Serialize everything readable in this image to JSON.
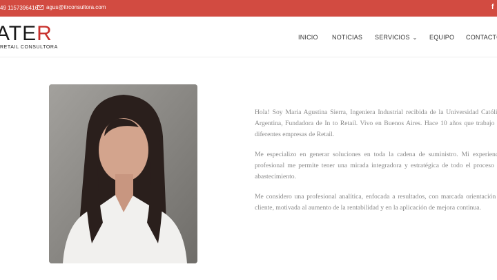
{
  "topbar": {
    "phone": "49 1157396416",
    "email": "agus@itrconsultora.com",
    "social_icon": "f"
  },
  "logo": {
    "mark_left": "ATE",
    "mark_right": "R",
    "subtitle": "RETAIL CONSULTORA"
  },
  "nav": {
    "items": [
      "INICIO",
      "NOTICIAS",
      "SERVICIOS",
      "EQUIPO",
      "CONTACTO"
    ]
  },
  "about": {
    "paragraphs": [
      "Hola! Soy Maria Agustina Sierra, Ingeniera Industrial recibida de la Universidad Católica Argentina, Fundadora de In to Retail. Vivo en Buenos Aires. Hace 10 años que trabajo en diferentes empresas de Retail.",
      "Me especializo en generar soluciones en toda la cadena de suministro. Mi experiencia profesional me permite tener una mirada integradora y estratégica de todo el proceso de abastecimiento.",
      "Me considero una profesional analítica, enfocada a resultados, con marcada orientación al cliente, motivada al aumento de la rentabilidad y en la aplicación de mejora continua."
    ]
  },
  "colors": {
    "brand_red": "#d24b41",
    "text_gray": "#8a8a8a"
  }
}
